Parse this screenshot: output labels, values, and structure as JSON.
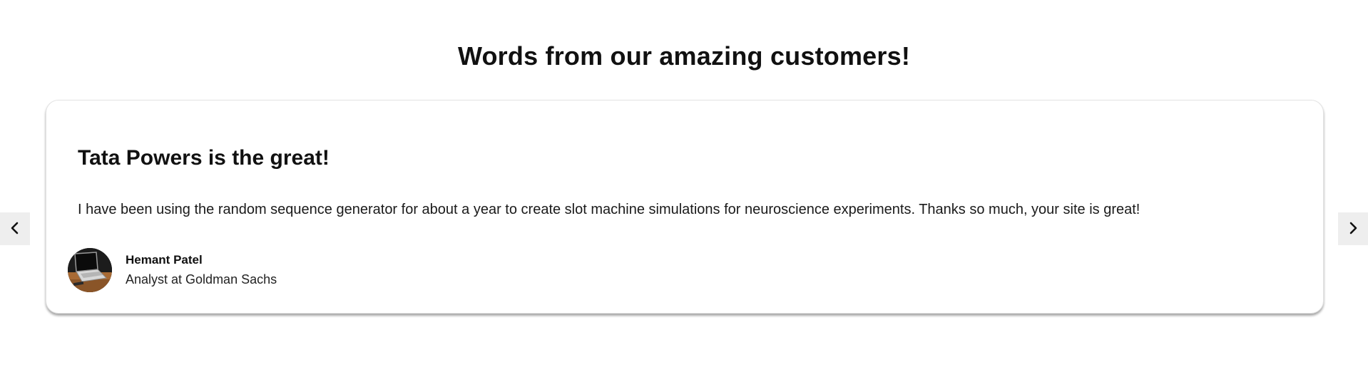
{
  "section": {
    "title": "Words from our amazing customers!"
  },
  "testimonial": {
    "title": "Tata Powers is the great!",
    "body": "I have been using the random sequence generator for about a year to create slot machine simulations for neuroscience experiments. Thanks so much, your site is great!",
    "author": {
      "name": "Hemant Patel",
      "role": "Analyst at Goldman Sachs",
      "avatar_icon": "laptop-photo"
    }
  },
  "navigation": {
    "prev_icon": "chevron-left-icon",
    "next_icon": "chevron-right-icon"
  },
  "colors": {
    "background": "#ffffff",
    "card_border": "#e2e2e2",
    "nav_button_bg": "#eeeeee",
    "text": "#111111"
  }
}
